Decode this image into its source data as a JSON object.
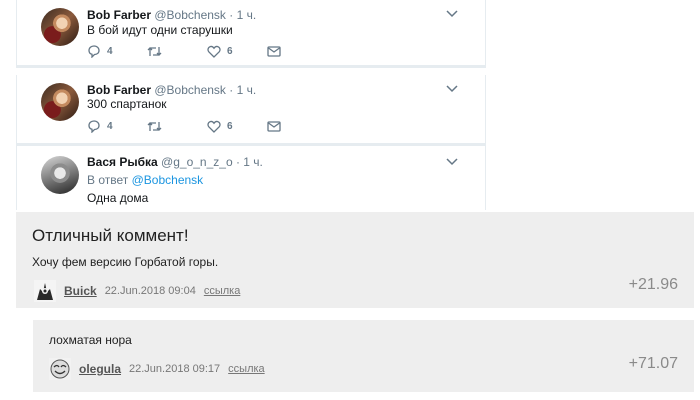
{
  "tweets": [
    {
      "name": "Bob Farber",
      "handle": "@Bobchensk · 1 ч.",
      "text": "В бой идут одни старушки",
      "reply_count": "4",
      "like_count": "6"
    },
    {
      "name": "Bob Farber",
      "handle": "@Bobchensk · 1 ч.",
      "text": "300 спартанок",
      "reply_count": "4",
      "like_count": "6"
    },
    {
      "name": "Вася Рыбка",
      "handle": "@g_o_n_z_o · 1 ч.",
      "reply_prefix": "В ответ",
      "reply_mention": "@Bobchensk",
      "text": "Одна дома"
    }
  ],
  "comments": [
    {
      "title": "Отличный коммент!",
      "text": "Хочу фем версию Горбатой горы.",
      "user": "Buick",
      "date": "22.Jun.2018 09:04",
      "link_label": "ссылка",
      "score": "+21.96"
    },
    {
      "text": "лохматая нора",
      "user": "olegula",
      "date": "22.Jun.2018 09:17",
      "link_label": "ссылка",
      "score": "+71.07"
    }
  ],
  "colors": {
    "twitter_gray": "#657786",
    "twitter_blue": "#1b95e0",
    "comment_bg": "#eeeeee"
  }
}
